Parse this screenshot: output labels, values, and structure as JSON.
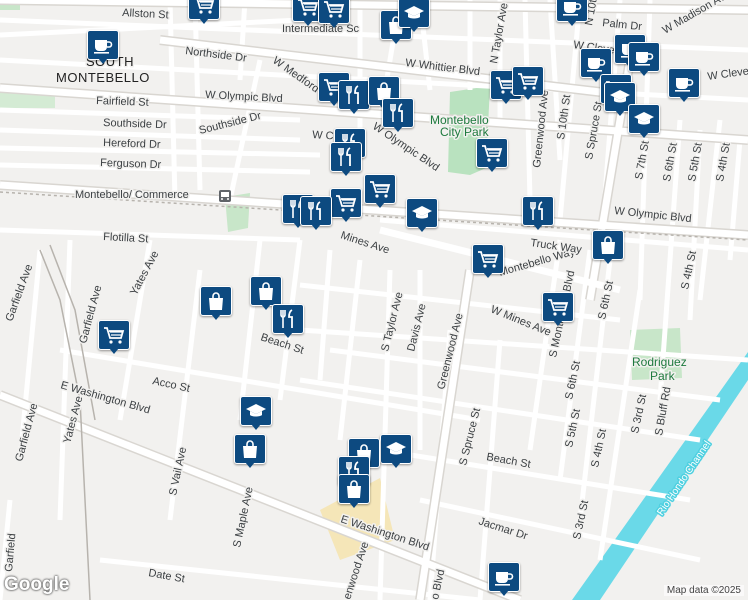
{
  "map": {
    "attribution": "Map data ©2025",
    "logo": "Google",
    "colors": {
      "background": "#f2f1ef",
      "road": "#ffffff",
      "road_edge": "#d9d6d1",
      "park": "#b9e2bf",
      "water": "#6ad9e8",
      "marker": "#0d4a80"
    }
  },
  "labels": {
    "allston": "Allston St",
    "northside": "Northside Dr",
    "south_montebello_1": "SOUTH",
    "south_montebello_2": "MONTEBELLO",
    "fairfield": "Fairfield St",
    "southside": "Southside Dr",
    "southside2": "Southside Dr",
    "hereford": "Hereford Dr",
    "ferguson": "Ferguson Dr",
    "w_olympic_1": "W Olympic Blvd",
    "w_olympic_2": "W Olympic Blvd",
    "w_olympic_3": "W Olympic Blvd",
    "w_whittier": "W Whittier Blvd",
    "w_medford": "W Medford",
    "w_co": "W Co",
    "montebello_commerce": "Montebello/ Commerce",
    "flotilla": "Flotilla St",
    "w_mines_1": "Mines Ave",
    "w_mines_2": "W Mines Ave",
    "yates_1": "Yates Ave",
    "yates_2": "Yates Ave",
    "garfield_1": "Garfield Ave",
    "garfield_2": "Garfield Ave",
    "garfield_3": "Garfield",
    "beach_1": "Beach St",
    "beach_2": "Beach St",
    "acco": "Acco St",
    "e_washington_1": "E Washington Blvd",
    "e_washington_2": "E Washington Blvd",
    "s_vail": "S Vail Ave",
    "s_maple": "S Maple Ave",
    "date": "Date St",
    "greenwood_1": "Greenwood Ave",
    "greenwood_2": "Greenwood Ave",
    "greenwood_3": "enwood Ave",
    "s_taylor": "S Taylor Ave",
    "n_taylor": "N Taylor Ave",
    "davis": "Davis Ave",
    "s_spruce_1": "S Spruce St",
    "s_spruce_2": "S Spruce St",
    "s_montebello": "S Montebello Blvd",
    "montebello_way": "Montebello Way",
    "truck_way": "Truck Way",
    "s_5th_1": "S 5th St",
    "s_5th_2": "S 5th St",
    "s_4th_1": "S 4th St",
    "s_4th_2": "S 4th St",
    "s_4th_3": "S 4th St",
    "s_3rd_1": "S 3rd St",
    "s_3rd_2": "S 3rd St",
    "s_6th_1": "S 6th St",
    "s_6th_2": "S 6th St",
    "s_6th_3": "S 6th St",
    "s_7th": "S 7th St",
    "s_10th": "S 10th St",
    "n_10th": "N 10th",
    "s_bluff": "S Bluff Rd",
    "jacmar": "Jacmar Dr",
    "palm": "Palm Dr",
    "w_madison": "W Madison Ave",
    "w_clev_1": "W Clevel",
    "w_clev_2": "W Clevela",
    "w_w": "W W",
    "rio_hondo": "Rio Hondo Channel",
    "rodriguez_1": "Rodriguez",
    "rodriguez_2": "Park",
    "montebello_city_park_1": "Montebello",
    "montebello_city_park_2": "City Park",
    "intermediate": "Intermediate Sc",
    "montebello_s": "Monte",
    "n_tyler": "N Taylor Ave",
    "greenwood_top": "Greenwood Ave",
    "blvd_bottom": "o Blvd"
  },
  "markers": [
    {
      "name": "coffee-marker",
      "icon": "coffee"
    },
    {
      "name": "cart-marker",
      "icon": "cart"
    },
    {
      "name": "bag-marker",
      "icon": "bag"
    },
    {
      "name": "restaurant-marker",
      "icon": "restaurant"
    },
    {
      "name": "school-marker",
      "icon": "school"
    },
    {
      "name": "bag-marker",
      "icon": "bag"
    }
  ]
}
